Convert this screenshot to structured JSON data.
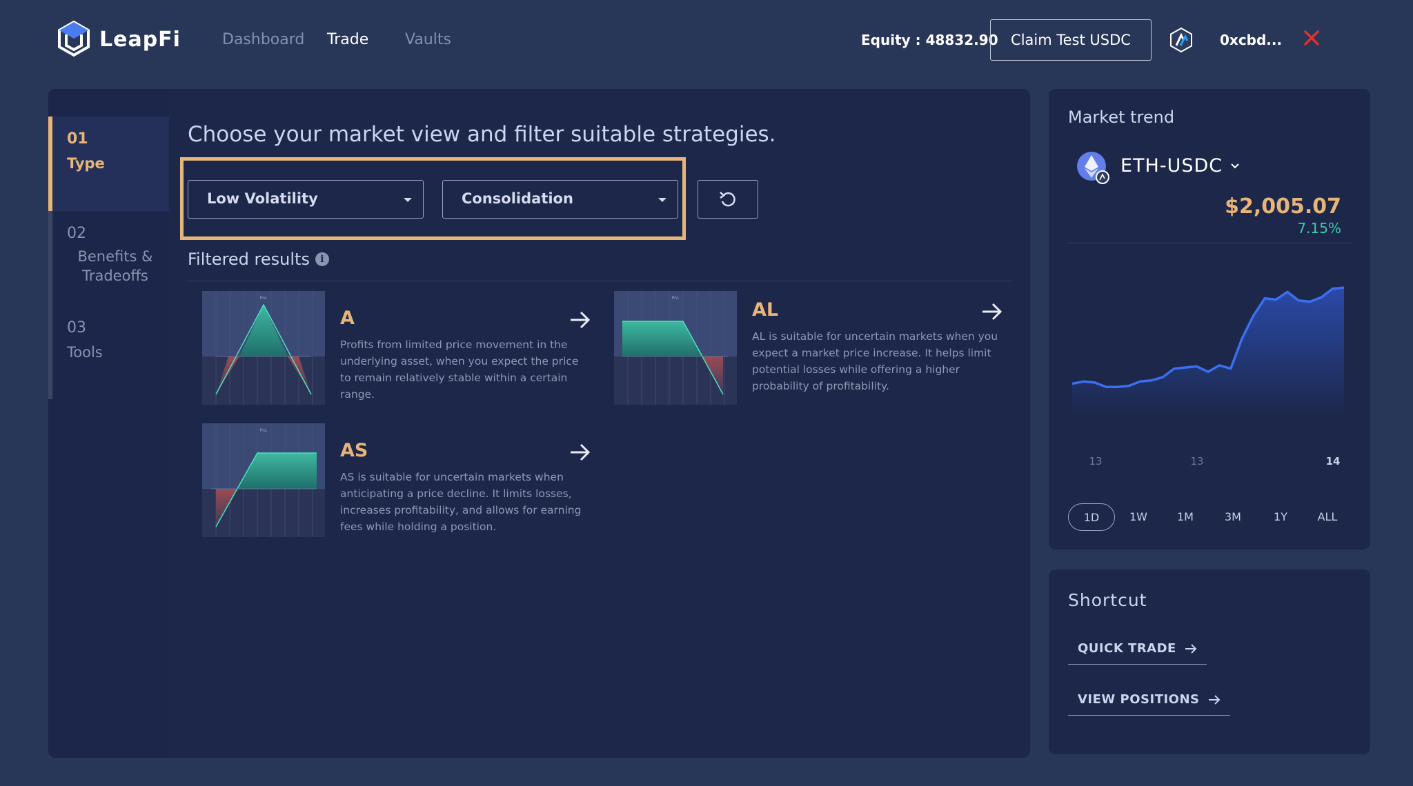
{
  "header": {
    "logo_text": "LeapFi",
    "nav": [
      "Dashboard",
      "Trade",
      "Vaults"
    ],
    "active_nav": "Trade",
    "equity": "Equity : 48832.90",
    "claim_button": "Claim Test USDC",
    "network_icon": "arbitrum-icon",
    "wallet": "0xcbd...",
    "close_icon": "close-icon",
    "colors": {
      "close": "#e0322e",
      "accent": "#e7b479"
    }
  },
  "steps": [
    {
      "num": "01",
      "label": "Type",
      "active": true
    },
    {
      "num": "02",
      "label": "Benefits & Tradeoffs",
      "active": false
    },
    {
      "num": "03",
      "label": "Tools",
      "active": false
    }
  ],
  "content": {
    "title": "Choose your market view and filter suitable strategies.",
    "filters": {
      "volatility": "Low Volatility",
      "trend": "Consolidation"
    },
    "reset_icon": "reset-icon",
    "filtered_label": "Filtered results",
    "info_icon": "info-icon"
  },
  "strategies": [
    {
      "name": "A",
      "description": "Profits from limited price movement in the underlying asset, when you expect the price to remain relatively stable within a certain range.",
      "thumbnail_label": "PnL"
    },
    {
      "name": "AL",
      "description": "AL is suitable for uncertain markets when you expect a market price increase. It helps limit potential losses while offering a higher probability of profitability.",
      "thumbnail_label": "PnL"
    },
    {
      "name": "AS",
      "description": "AS is suitable for uncertain markets when anticipating a price decline. It limits losses, increases profitability, and allows for earning fees while holding a position.",
      "thumbnail_label": "PnL"
    }
  ],
  "market_trend": {
    "title": "Market trend",
    "pair": "ETH-USDC",
    "price": "$2,005.07",
    "change": "7.15%",
    "x_labels": [
      "13",
      "13",
      "14"
    ],
    "ranges": [
      "1D",
      "1W",
      "1M",
      "3M",
      "1Y",
      "ALL"
    ],
    "active_range": "1D",
    "colors": {
      "line": "#3a6ff0",
      "price": "#e7b479",
      "change": "#3ec9b0"
    }
  },
  "chart_data": {
    "type": "area",
    "title": "",
    "xlabel": "",
    "ylabel": "",
    "x_ticks": [
      "13",
      "13",
      "14"
    ],
    "series": [
      {
        "values": [
          1943,
          1945,
          1944,
          1940,
          1940,
          1941,
          1945,
          1946,
          1949,
          1957,
          1958,
          1959,
          1954,
          1960,
          1957,
          1985,
          2006,
          2022,
          2021,
          2028,
          2020,
          2019,
          2023,
          2031,
          2032
        ]
      }
    ],
    "grid": false,
    "legend": "none"
  },
  "shortcut": {
    "title": "Shortcut",
    "links": [
      "QUICK TRADE",
      "VIEW POSITIONS"
    ]
  }
}
